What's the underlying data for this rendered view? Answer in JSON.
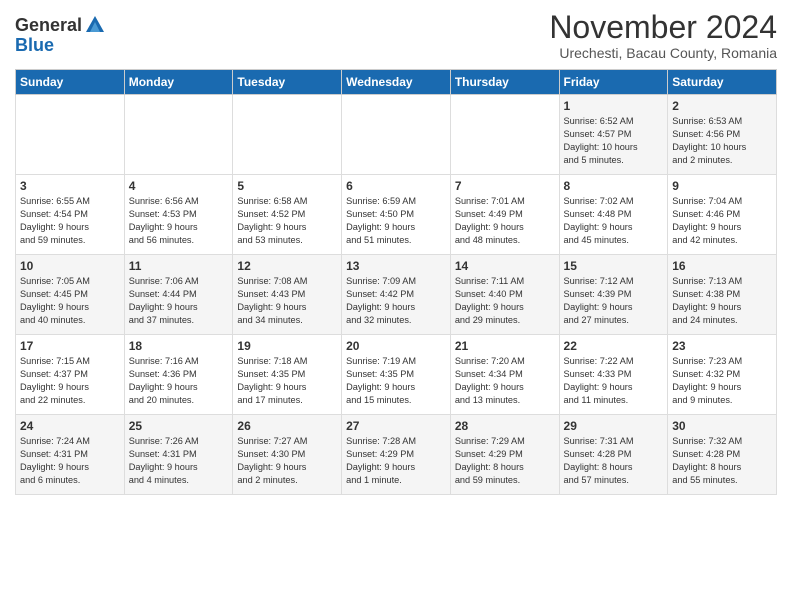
{
  "header": {
    "logo_general": "General",
    "logo_blue": "Blue",
    "month_title": "November 2024",
    "location": "Urechesti, Bacau County, Romania"
  },
  "calendar": {
    "days_of_week": [
      "Sunday",
      "Monday",
      "Tuesday",
      "Wednesday",
      "Thursday",
      "Friday",
      "Saturday"
    ],
    "weeks": [
      [
        {
          "day": "",
          "info": ""
        },
        {
          "day": "",
          "info": ""
        },
        {
          "day": "",
          "info": ""
        },
        {
          "day": "",
          "info": ""
        },
        {
          "day": "",
          "info": ""
        },
        {
          "day": "1",
          "info": "Sunrise: 6:52 AM\nSunset: 4:57 PM\nDaylight: 10 hours\nand 5 minutes."
        },
        {
          "day": "2",
          "info": "Sunrise: 6:53 AM\nSunset: 4:56 PM\nDaylight: 10 hours\nand 2 minutes."
        }
      ],
      [
        {
          "day": "3",
          "info": "Sunrise: 6:55 AM\nSunset: 4:54 PM\nDaylight: 9 hours\nand 59 minutes."
        },
        {
          "day": "4",
          "info": "Sunrise: 6:56 AM\nSunset: 4:53 PM\nDaylight: 9 hours\nand 56 minutes."
        },
        {
          "day": "5",
          "info": "Sunrise: 6:58 AM\nSunset: 4:52 PM\nDaylight: 9 hours\nand 53 minutes."
        },
        {
          "day": "6",
          "info": "Sunrise: 6:59 AM\nSunset: 4:50 PM\nDaylight: 9 hours\nand 51 minutes."
        },
        {
          "day": "7",
          "info": "Sunrise: 7:01 AM\nSunset: 4:49 PM\nDaylight: 9 hours\nand 48 minutes."
        },
        {
          "day": "8",
          "info": "Sunrise: 7:02 AM\nSunset: 4:48 PM\nDaylight: 9 hours\nand 45 minutes."
        },
        {
          "day": "9",
          "info": "Sunrise: 7:04 AM\nSunset: 4:46 PM\nDaylight: 9 hours\nand 42 minutes."
        }
      ],
      [
        {
          "day": "10",
          "info": "Sunrise: 7:05 AM\nSunset: 4:45 PM\nDaylight: 9 hours\nand 40 minutes."
        },
        {
          "day": "11",
          "info": "Sunrise: 7:06 AM\nSunset: 4:44 PM\nDaylight: 9 hours\nand 37 minutes."
        },
        {
          "day": "12",
          "info": "Sunrise: 7:08 AM\nSunset: 4:43 PM\nDaylight: 9 hours\nand 34 minutes."
        },
        {
          "day": "13",
          "info": "Sunrise: 7:09 AM\nSunset: 4:42 PM\nDaylight: 9 hours\nand 32 minutes."
        },
        {
          "day": "14",
          "info": "Sunrise: 7:11 AM\nSunset: 4:40 PM\nDaylight: 9 hours\nand 29 minutes."
        },
        {
          "day": "15",
          "info": "Sunrise: 7:12 AM\nSunset: 4:39 PM\nDaylight: 9 hours\nand 27 minutes."
        },
        {
          "day": "16",
          "info": "Sunrise: 7:13 AM\nSunset: 4:38 PM\nDaylight: 9 hours\nand 24 minutes."
        }
      ],
      [
        {
          "day": "17",
          "info": "Sunrise: 7:15 AM\nSunset: 4:37 PM\nDaylight: 9 hours\nand 22 minutes."
        },
        {
          "day": "18",
          "info": "Sunrise: 7:16 AM\nSunset: 4:36 PM\nDaylight: 9 hours\nand 20 minutes."
        },
        {
          "day": "19",
          "info": "Sunrise: 7:18 AM\nSunset: 4:35 PM\nDaylight: 9 hours\nand 17 minutes."
        },
        {
          "day": "20",
          "info": "Sunrise: 7:19 AM\nSunset: 4:35 PM\nDaylight: 9 hours\nand 15 minutes."
        },
        {
          "day": "21",
          "info": "Sunrise: 7:20 AM\nSunset: 4:34 PM\nDaylight: 9 hours\nand 13 minutes."
        },
        {
          "day": "22",
          "info": "Sunrise: 7:22 AM\nSunset: 4:33 PM\nDaylight: 9 hours\nand 11 minutes."
        },
        {
          "day": "23",
          "info": "Sunrise: 7:23 AM\nSunset: 4:32 PM\nDaylight: 9 hours\nand 9 minutes."
        }
      ],
      [
        {
          "day": "24",
          "info": "Sunrise: 7:24 AM\nSunset: 4:31 PM\nDaylight: 9 hours\nand 6 minutes."
        },
        {
          "day": "25",
          "info": "Sunrise: 7:26 AM\nSunset: 4:31 PM\nDaylight: 9 hours\nand 4 minutes."
        },
        {
          "day": "26",
          "info": "Sunrise: 7:27 AM\nSunset: 4:30 PM\nDaylight: 9 hours\nand 2 minutes."
        },
        {
          "day": "27",
          "info": "Sunrise: 7:28 AM\nSunset: 4:29 PM\nDaylight: 9 hours\nand 1 minute."
        },
        {
          "day": "28",
          "info": "Sunrise: 7:29 AM\nSunset: 4:29 PM\nDaylight: 8 hours\nand 59 minutes."
        },
        {
          "day": "29",
          "info": "Sunrise: 7:31 AM\nSunset: 4:28 PM\nDaylight: 8 hours\nand 57 minutes."
        },
        {
          "day": "30",
          "info": "Sunrise: 7:32 AM\nSunset: 4:28 PM\nDaylight: 8 hours\nand 55 minutes."
        }
      ]
    ]
  }
}
